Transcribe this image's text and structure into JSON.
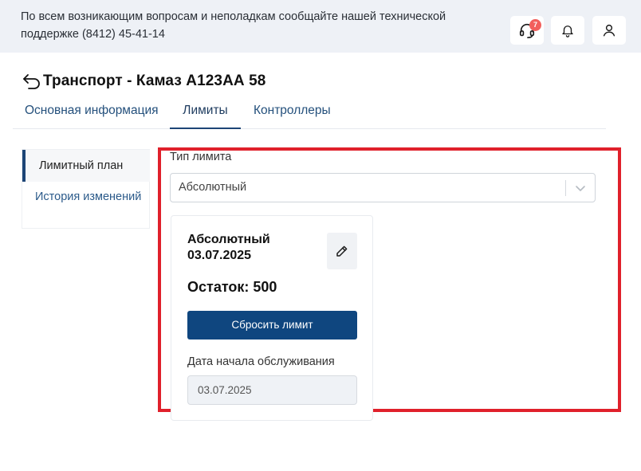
{
  "topbar": {
    "notice": "По всем возникающим вопросам и неполадкам сообщайте нашей технической поддержке (8412) 45-41-14",
    "support_badge": "7"
  },
  "page": {
    "title": "Транспорт - Камаз А123АА 58"
  },
  "tabs": [
    {
      "label": "Основная информация",
      "active": false
    },
    {
      "label": "Лимиты",
      "active": true
    },
    {
      "label": "Контроллеры",
      "active": false
    }
  ],
  "side_nav": {
    "items": [
      {
        "label": "Лимитный план",
        "active": true
      },
      {
        "label": "История изменений",
        "active": false
      }
    ]
  },
  "limit_type": {
    "label": "Тип лимита",
    "value": "Абсолютный"
  },
  "card": {
    "title": "Абсолютный 03.07.2025",
    "remain": "Остаток: 500",
    "reset_label": "Сбросить лимит",
    "date_label": "Дата начала обслуживания",
    "date_value": "03.07.2025"
  },
  "colors": {
    "accent": "#0f467f",
    "highlight": "#e0202b",
    "badge": "#f25f5c"
  }
}
